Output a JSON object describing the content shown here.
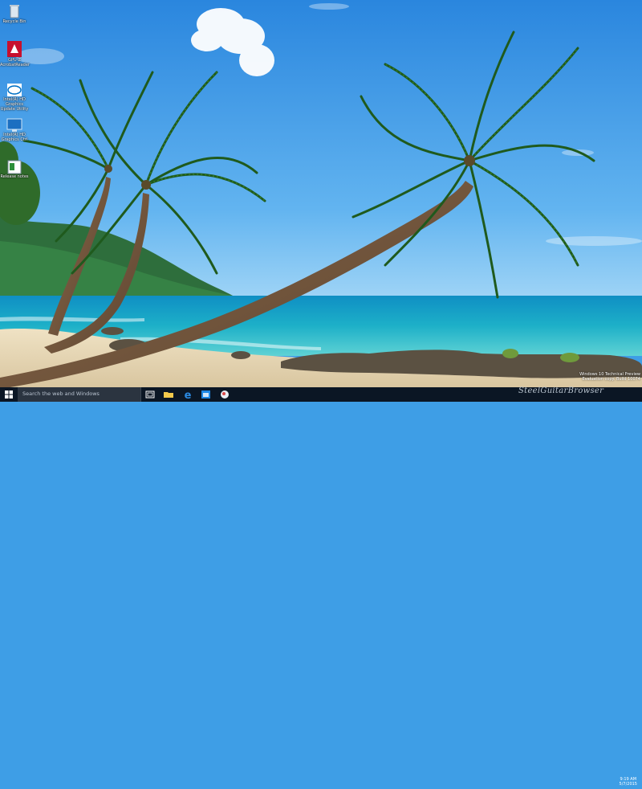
{
  "desktop": {
    "icons": [
      {
        "id": "recycle-bin",
        "label": "Recycle Bin",
        "icon": "recycle-bin-icon"
      },
      {
        "id": "gpu-z",
        "label": "GPU-Z\nAcrobatReader",
        "icon": "app-icon"
      },
      {
        "id": "intel-hd",
        "label": "Intel(R) HD Graphics\nUpdate Utility",
        "icon": "intel-icon"
      },
      {
        "id": "intel-graphics",
        "label": "Intel(R) HD\nGraphics Ctrl",
        "icon": "monitor-icon"
      },
      {
        "id": "release-notes",
        "label": "Release notes",
        "icon": "document-icon"
      }
    ]
  },
  "watermark": {
    "line1": "Windows 10 Technical Preview",
    "line2": "Evaluation copy. Build 10074"
  },
  "site_watermark": "SteelGuitarBrowser",
  "taskbar": {
    "search_placeholder": "Search the web and Windows",
    "icons": [
      "start-icon",
      "task-view-icon",
      "file-explorer-icon",
      "edge-icon",
      "store-icon",
      "app-icon"
    ],
    "clock_time": "9:19 AM",
    "clock_date": "5/7/2015"
  },
  "colors": {
    "sky_top": "#2f8de0",
    "sky_bottom": "#7cc3f2",
    "sea": "#1aa3c8",
    "sand": "#e9dcc0",
    "taskbar": "#0b1624"
  }
}
